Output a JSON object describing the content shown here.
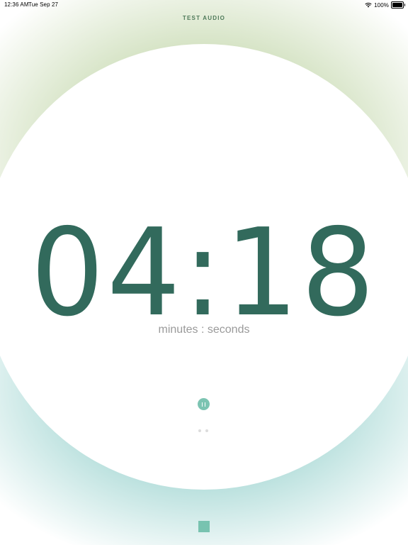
{
  "status_bar": {
    "time": "12:36 AM",
    "date": "Tue Sep 27",
    "battery": "100%"
  },
  "header": {
    "test_audio_label": "TEST AUDIO"
  },
  "timer": {
    "display": "04:18",
    "caption": "minutes : seconds"
  },
  "controls": {
    "pause_icon": "pause-icon",
    "stop_icon": "stop-square-icon"
  },
  "pager": {
    "page_count": 2
  },
  "colors": {
    "accent_green": "#326a5c",
    "accent_teal": "#7cc4b2",
    "halo_top": "#acc88c",
    "halo_bottom": "#6ebeb9",
    "caption_gray": "#9a9a9a"
  }
}
